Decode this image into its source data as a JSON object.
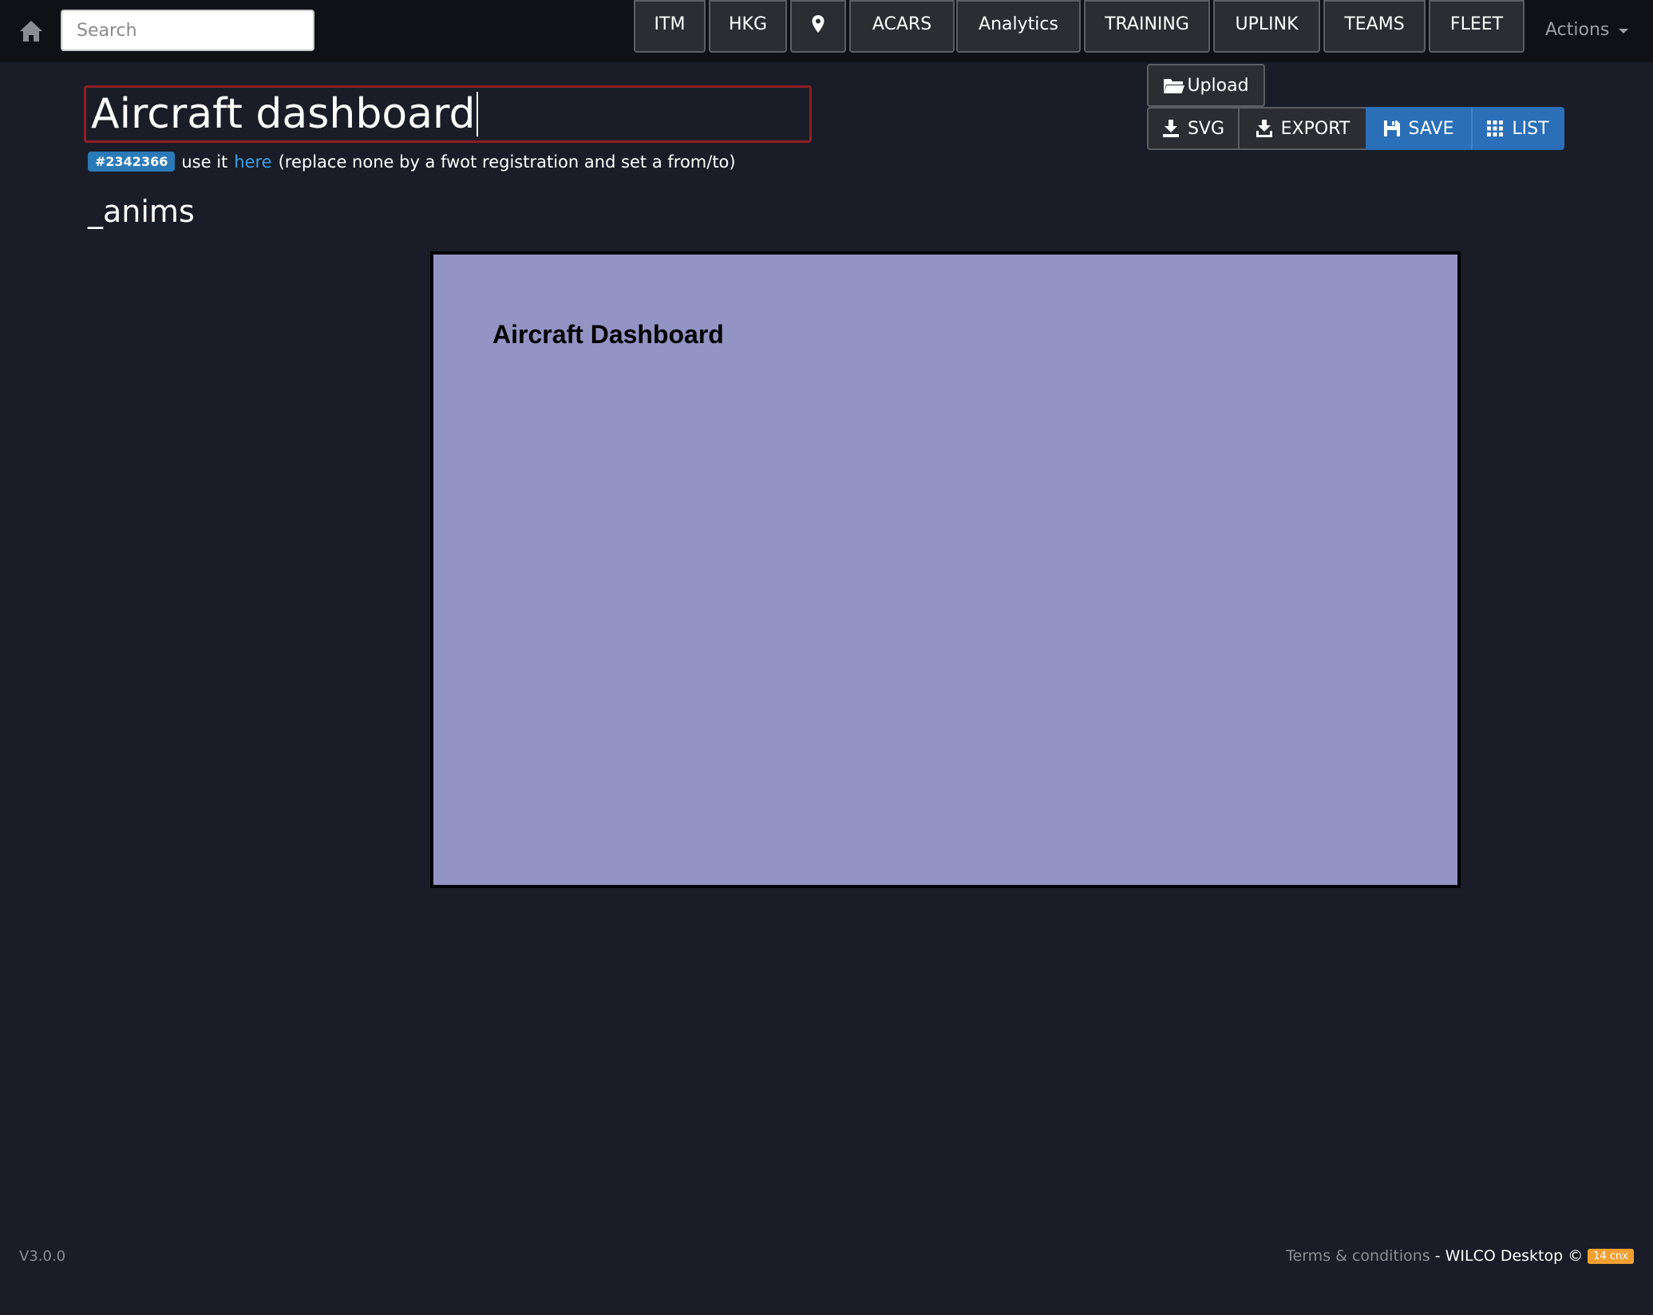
{
  "navbar": {
    "search_placeholder": "Search",
    "buttons": [
      {
        "label": "ITM"
      },
      {
        "label": "HKG"
      },
      {
        "label": ""
      },
      {
        "label": "ACARS"
      },
      {
        "label": "Analytics"
      },
      {
        "label": "TRAINING"
      },
      {
        "label": "UPLINK"
      },
      {
        "label": "TEAMS"
      },
      {
        "label": "FLEET"
      }
    ],
    "icons": {
      "home": "home-icon",
      "location": "map-pin-icon"
    },
    "actions_label": "Actions"
  },
  "header": {
    "title_value": "Aircraft dashboard",
    "id_badge": "#2342366",
    "info_prefix": "use it",
    "info_link": "here",
    "info_suffix": "(replace none by a fwot registration and set a from/to)",
    "section_heading": "_anims"
  },
  "toolbar": {
    "upload_label": "Upload",
    "svg_label": "SVG",
    "export_label": "EXPORT",
    "save_label": "SAVE",
    "list_label": "LIST",
    "icons": {
      "upload": "folder-open-icon",
      "svg": "download-icon",
      "export": "export-icon",
      "save": "floppy-disk-icon",
      "list": "grid-icon"
    }
  },
  "preview": {
    "title": "Aircraft Dashboard",
    "background": "#9394c4"
  },
  "footer": {
    "version": "V3.0.0",
    "terms_link": "Terms & conditions",
    "separator": "-",
    "brand": "WILCO Desktop ©",
    "badge": "14 cnx"
  },
  "colors": {
    "page_bg": "#1a1d27",
    "navbar_bg": "#0f1116",
    "accent_blue": "#2a6fb8",
    "title_border": "#8f1d24",
    "badge_orange": "#f0a030"
  }
}
